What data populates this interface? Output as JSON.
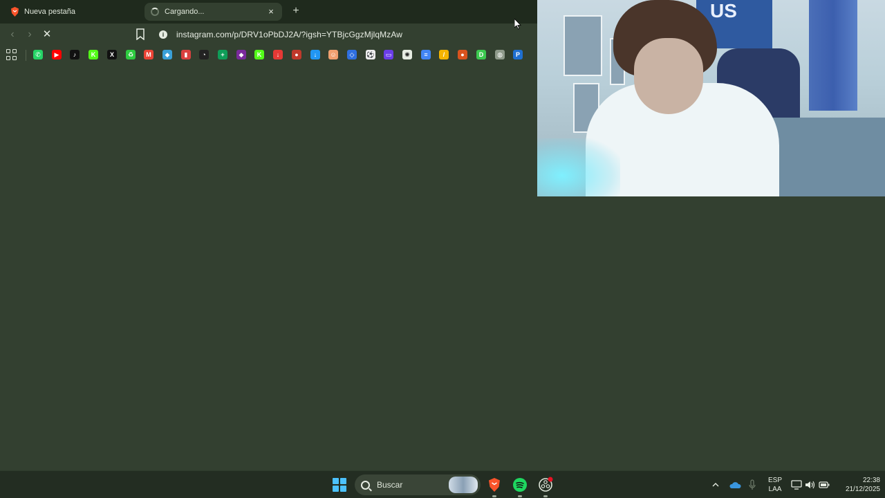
{
  "tabs": [
    {
      "title": "Nueva pestaña",
      "active": false
    },
    {
      "title": "Cargando...",
      "active": true
    }
  ],
  "tab_close_glyph": "×",
  "new_tab_glyph": "+",
  "toolbar": {
    "back_glyph": "‹",
    "forward_glyph": "›",
    "stop_glyph": "✕",
    "url": "instagram.com/p/DRV1oPbDJ2A/?igsh=YTBjcGgzMjlqMzAw"
  },
  "bookmarks": [
    {
      "icon": "whatsapp-icon",
      "color": "#25d366",
      "glyph": "✆"
    },
    {
      "icon": "youtube-icon",
      "color": "#ff0000",
      "glyph": "▶"
    },
    {
      "icon": "tiktok-icon",
      "color": "#111111",
      "glyph": "♪"
    },
    {
      "icon": "kick-icon",
      "color": "#53fc18",
      "glyph": "K"
    },
    {
      "icon": "x-icon",
      "color": "#111111",
      "glyph": "X"
    },
    {
      "icon": "recycle-icon",
      "color": "#2ecc40",
      "glyph": "♻"
    },
    {
      "icon": "gmail-icon",
      "color": "#ea4335",
      "glyph": "M"
    },
    {
      "icon": "extension-icon",
      "color": "#3aa0d8",
      "glyph": "◆"
    },
    {
      "icon": "chart-icon",
      "color": "#d9413f",
      "glyph": "▮"
    },
    {
      "icon": "speedometer-icon",
      "color": "#222222",
      "glyph": "◔"
    },
    {
      "icon": "sheets-icon",
      "color": "#0f9d58",
      "glyph": "+"
    },
    {
      "icon": "twitch-icon",
      "color": "#7a2a9c",
      "glyph": "◆"
    },
    {
      "icon": "kick-icon",
      "color": "#53fc18",
      "glyph": "K"
    },
    {
      "icon": "download-red-icon",
      "color": "#e53935",
      "glyph": "↓"
    },
    {
      "icon": "shield-icon",
      "color": "#c0392b",
      "glyph": "●"
    },
    {
      "icon": "download-blue-icon",
      "color": "#2196f3",
      "glyph": "↓"
    },
    {
      "icon": "avatar-icon",
      "color": "#f0a070",
      "glyph": "☺"
    },
    {
      "icon": "dropbox-icon",
      "color": "#2f6fe0",
      "glyph": "◇"
    },
    {
      "icon": "football-icon",
      "color": "#eeeeee",
      "glyph": "⚽"
    },
    {
      "icon": "window-icon",
      "color": "#6a3de8",
      "glyph": "▭"
    },
    {
      "icon": "openai-icon",
      "color": "#e6ece2",
      "glyph": "✺"
    },
    {
      "icon": "docs-icon",
      "color": "#4285f4",
      "glyph": "≡"
    },
    {
      "icon": "pen-icon",
      "color": "#f4b400",
      "glyph": "/"
    },
    {
      "icon": "orange-circle-icon",
      "color": "#d9531e",
      "glyph": "●"
    },
    {
      "icon": "d-icon",
      "color": "#3cc94f",
      "glyph": "D"
    },
    {
      "icon": "globe-icon",
      "color": "#8f9a8b",
      "glyph": "◍"
    },
    {
      "icon": "paypal-icon",
      "color": "#1f6fd1",
      "glyph": "P"
    }
  ],
  "webcam": {
    "banner_text": "US"
  },
  "taskbar": {
    "search_label": "Buscar",
    "apps": [
      {
        "icon": "brave-icon",
        "color": "#fb542b"
      },
      {
        "icon": "spotify-icon",
        "color": "#1ed760"
      },
      {
        "icon": "obs-icon",
        "color": "#dfe6da"
      }
    ],
    "language_1": "ESP",
    "language_2": "LAA",
    "time": "22:38",
    "date": "21/12/2025"
  }
}
